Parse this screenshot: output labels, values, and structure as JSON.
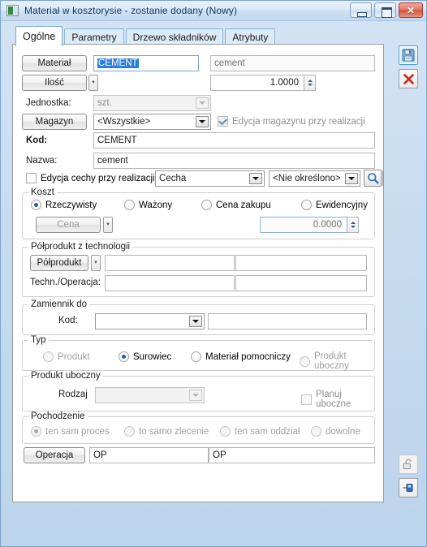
{
  "window": {
    "title": "Materiał w kosztorysie - zostanie dodany  (Nowy)",
    "icon": "app-window-icon",
    "buttons": {
      "minimize": "minimize-button",
      "maximize": "maximize-button",
      "close_glyph": "✕"
    }
  },
  "tabs": [
    {
      "label": "Ogólne",
      "active": true
    },
    {
      "label": "Parametry",
      "active": false
    },
    {
      "label": "Drzewo składników",
      "active": false
    },
    {
      "label": "Atrybuty",
      "active": false
    }
  ],
  "form": {
    "material_button": "Materiał",
    "material_code": "CEMENT",
    "material_name": "cement",
    "quantity_button": "Ilość",
    "quantity_value": "1.0000",
    "unit_label": "Jednostka:",
    "unit_value": "szt.",
    "warehouse_button": "Magazyn",
    "warehouse_value": "<Wszystkie>",
    "warehouse_edit_checkbox": "Edycja magazynu przy realizacji",
    "kod_label": "Kod:",
    "kod_value": "CEMENT",
    "nazwa_label": "Nazwa:",
    "nazwa_value": "cement",
    "feature_edit_checkbox": "Edycja cechy przy realizacji",
    "feature_combo": "Cecha",
    "feature_value_combo": "<Nie określono>",
    "search_icon": "magnifier-icon"
  },
  "koszt": {
    "legend": "Koszt",
    "options": [
      {
        "label": "Rzeczywisty",
        "selected": true
      },
      {
        "label": "Ważony",
        "selected": false
      },
      {
        "label": "Cena zakupu",
        "selected": false
      },
      {
        "label": "Ewidencyjny",
        "selected": false
      }
    ],
    "price_button": "Cena",
    "price_value": "0.0000"
  },
  "polprodukt": {
    "legend": "Półprodukt z technologii",
    "button": "Półprodukt",
    "field_left": "",
    "field_right": "",
    "techn_label": "Techn./Operacja:",
    "techn_left": "",
    "techn_right": ""
  },
  "zamiennik": {
    "legend": "Zamiennik do",
    "kod_label": "Kod:",
    "kod_value": "",
    "name_value": ""
  },
  "typ": {
    "legend": "Typ",
    "options": [
      {
        "label": "Produkt",
        "selected": false,
        "disabled": true
      },
      {
        "label": "Surowiec",
        "selected": true,
        "disabled": false
      },
      {
        "label": "Materiał pomocniczy",
        "selected": false,
        "disabled": false
      },
      {
        "label": "Produkt uboczny",
        "selected": false,
        "disabled": true
      }
    ]
  },
  "produkt_uboczny": {
    "legend": "Produkt uboczny",
    "rodzaj_label": "Rodzaj",
    "rodzaj_value": "",
    "plan_checkbox": "Planuj uboczne"
  },
  "pochodzenie": {
    "legend": "Pochodzenie",
    "options": [
      {
        "label": "ten sam proces",
        "selected": true
      },
      {
        "label": "to samo zlecenie",
        "selected": false
      },
      {
        "label": "ten sam oddział",
        "selected": false
      },
      {
        "label": "dowolne",
        "selected": false
      }
    ]
  },
  "operacja": {
    "button": "Operacja",
    "code": "OP",
    "name": "OP"
  },
  "toolbar": {
    "save": "save-floppy-icon",
    "cancel": "cancel-x-icon",
    "lock": "padlock-open-icon",
    "pin": "pin-save-icon"
  },
  "colors": {
    "accent": "#2a6099",
    "selection": "#2a7fd4",
    "frame": "#bcd4ec",
    "close": "#d1553f"
  }
}
